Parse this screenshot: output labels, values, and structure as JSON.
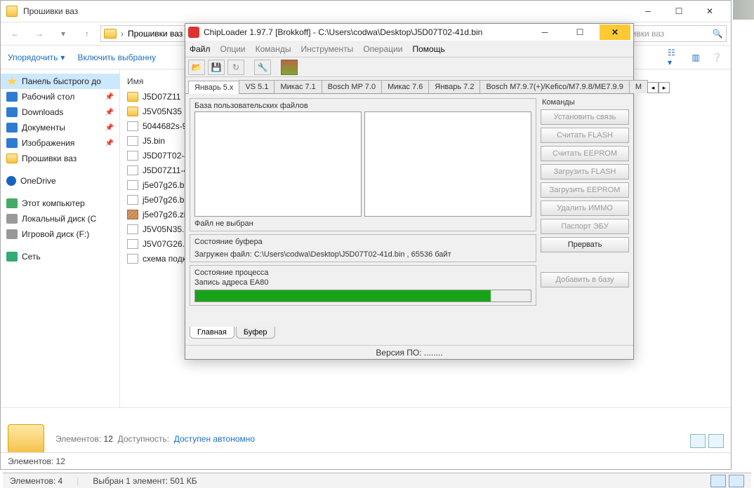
{
  "explorer": {
    "title": "Прошивки ваз",
    "breadcrumb": "Прошивки ваз",
    "search_placeholder": "шивки ваз",
    "toolbar": {
      "organize": "Упорядочить",
      "include": "Включить выбранну"
    },
    "nav": {
      "quick": "Панель быстрого до",
      "desktop": "Рабочий стол",
      "downloads": "Downloads",
      "documents": "Документы",
      "images": "Изображения",
      "firmware": "Прошивки ваз",
      "onedrive": "OneDrive",
      "thispc": "Этот компьютер",
      "localdisk": "Локальный диск (C",
      "gamedisk": "Игровой диск (F:)",
      "network": "Сеть"
    },
    "col_name": "Имя",
    "files": [
      {
        "icon": "folder",
        "name": "J5D07Z11"
      },
      {
        "icon": "folder",
        "name": "J5V05N35"
      },
      {
        "icon": "file",
        "name": "5044682s-96"
      },
      {
        "icon": "file",
        "name": "J5.bin"
      },
      {
        "icon": "file",
        "name": "J5D07T02-41"
      },
      {
        "icon": "file",
        "name": "J5D07Z11-41"
      },
      {
        "icon": "file",
        "name": "j5e07g26.bin"
      },
      {
        "icon": "file",
        "name": "j5e07g26.bin"
      },
      {
        "icon": "zip",
        "name": "j5e07g26.zip"
      },
      {
        "icon": "file",
        "name": "J5V05N35.bin"
      },
      {
        "icon": "file",
        "name": "J5V07G26.bin"
      },
      {
        "icon": "file",
        "name": "схема подкл"
      }
    ],
    "footer": {
      "elements_label": "Элементов:",
      "elements_count": "12",
      "avail_label": "Доступность:",
      "avail_value": "Доступен автономно"
    },
    "status2": "Элементов: 12"
  },
  "chip": {
    "title": "ChipLoader 1.97.7 [Brokkoff] - C:\\Users\\codwa\\Desktop\\J5D07T02-41d.bin",
    "menu": {
      "file": "Файл",
      "options": "Опции",
      "commands": "Команды",
      "tools": "Инструменты",
      "ops": "Операции",
      "help": "Помощь"
    },
    "tabs": [
      "Январь 5.x",
      "VS 5.1",
      "Микас 7.1",
      "Bosch MP 7.0",
      "Микас 7.6",
      "Январь 7.2",
      "Bosch M7.9.7(+)/Kefico/M7.9.8/ME7.9.9",
      "M"
    ],
    "userfiles_label": "База пользовательских файлов",
    "nofile": "Файл не выбран",
    "buffer_label": "Состояние буфера",
    "buffer_text": "Загружен файл: C:\\Users\\codwa\\Desktop\\J5D07T02-41d.bin , 65536 байт",
    "process_label": "Состояние процесса",
    "process_text": "Запись адреса EA80",
    "side": {
      "title": "Команды",
      "b1": "Установить связь",
      "b2": "Считать FLASH",
      "b3": "Считать EEPROM",
      "b4": "Загрузить FLASH",
      "b5": "Загрузить EEPROM",
      "b6": "Удалить ИММО",
      "b7": "Паспорт ЭБУ",
      "b8": "Прервать",
      "b9": "Добавить в базу"
    },
    "btabs": {
      "main": "Главная",
      "buf": "Буфер"
    },
    "status": "Версия ПО: ........"
  },
  "bottom": {
    "elements": "Элементов: 4",
    "selected": "Выбран 1 элемент: 501 КБ"
  }
}
